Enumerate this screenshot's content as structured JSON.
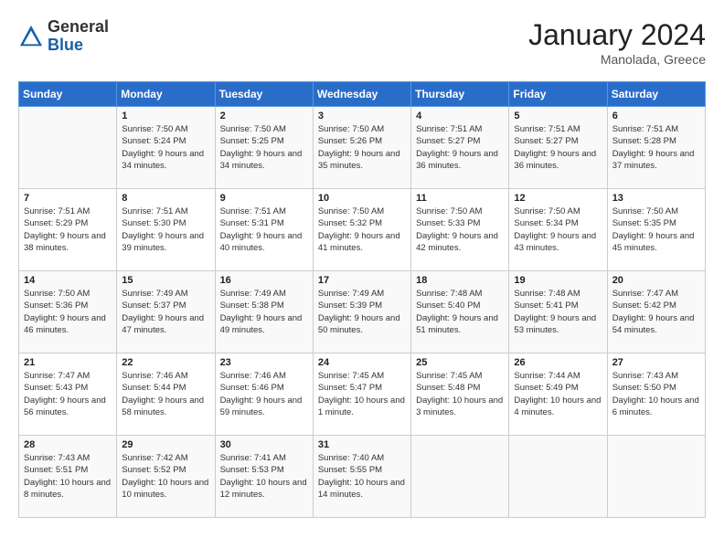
{
  "header": {
    "logo_general": "General",
    "logo_blue": "Blue",
    "month_year": "January 2024",
    "location": "Manolada, Greece"
  },
  "columns": [
    "Sunday",
    "Monday",
    "Tuesday",
    "Wednesday",
    "Thursday",
    "Friday",
    "Saturday"
  ],
  "weeks": [
    [
      {
        "day": "",
        "sunrise": "",
        "sunset": "",
        "daylight": ""
      },
      {
        "day": "1",
        "sunrise": "Sunrise: 7:50 AM",
        "sunset": "Sunset: 5:24 PM",
        "daylight": "Daylight: 9 hours and 34 minutes."
      },
      {
        "day": "2",
        "sunrise": "Sunrise: 7:50 AM",
        "sunset": "Sunset: 5:25 PM",
        "daylight": "Daylight: 9 hours and 34 minutes."
      },
      {
        "day": "3",
        "sunrise": "Sunrise: 7:50 AM",
        "sunset": "Sunset: 5:26 PM",
        "daylight": "Daylight: 9 hours and 35 minutes."
      },
      {
        "day": "4",
        "sunrise": "Sunrise: 7:51 AM",
        "sunset": "Sunset: 5:27 PM",
        "daylight": "Daylight: 9 hours and 36 minutes."
      },
      {
        "day": "5",
        "sunrise": "Sunrise: 7:51 AM",
        "sunset": "Sunset: 5:27 PM",
        "daylight": "Daylight: 9 hours and 36 minutes."
      },
      {
        "day": "6",
        "sunrise": "Sunrise: 7:51 AM",
        "sunset": "Sunset: 5:28 PM",
        "daylight": "Daylight: 9 hours and 37 minutes."
      }
    ],
    [
      {
        "day": "7",
        "sunrise": "Sunrise: 7:51 AM",
        "sunset": "Sunset: 5:29 PM",
        "daylight": "Daylight: 9 hours and 38 minutes."
      },
      {
        "day": "8",
        "sunrise": "Sunrise: 7:51 AM",
        "sunset": "Sunset: 5:30 PM",
        "daylight": "Daylight: 9 hours and 39 minutes."
      },
      {
        "day": "9",
        "sunrise": "Sunrise: 7:51 AM",
        "sunset": "Sunset: 5:31 PM",
        "daylight": "Daylight: 9 hours and 40 minutes."
      },
      {
        "day": "10",
        "sunrise": "Sunrise: 7:50 AM",
        "sunset": "Sunset: 5:32 PM",
        "daylight": "Daylight: 9 hours and 41 minutes."
      },
      {
        "day": "11",
        "sunrise": "Sunrise: 7:50 AM",
        "sunset": "Sunset: 5:33 PM",
        "daylight": "Daylight: 9 hours and 42 minutes."
      },
      {
        "day": "12",
        "sunrise": "Sunrise: 7:50 AM",
        "sunset": "Sunset: 5:34 PM",
        "daylight": "Daylight: 9 hours and 43 minutes."
      },
      {
        "day": "13",
        "sunrise": "Sunrise: 7:50 AM",
        "sunset": "Sunset: 5:35 PM",
        "daylight": "Daylight: 9 hours and 45 minutes."
      }
    ],
    [
      {
        "day": "14",
        "sunrise": "Sunrise: 7:50 AM",
        "sunset": "Sunset: 5:36 PM",
        "daylight": "Daylight: 9 hours and 46 minutes."
      },
      {
        "day": "15",
        "sunrise": "Sunrise: 7:49 AM",
        "sunset": "Sunset: 5:37 PM",
        "daylight": "Daylight: 9 hours and 47 minutes."
      },
      {
        "day": "16",
        "sunrise": "Sunrise: 7:49 AM",
        "sunset": "Sunset: 5:38 PM",
        "daylight": "Daylight: 9 hours and 49 minutes."
      },
      {
        "day": "17",
        "sunrise": "Sunrise: 7:49 AM",
        "sunset": "Sunset: 5:39 PM",
        "daylight": "Daylight: 9 hours and 50 minutes."
      },
      {
        "day": "18",
        "sunrise": "Sunrise: 7:48 AM",
        "sunset": "Sunset: 5:40 PM",
        "daylight": "Daylight: 9 hours and 51 minutes."
      },
      {
        "day": "19",
        "sunrise": "Sunrise: 7:48 AM",
        "sunset": "Sunset: 5:41 PM",
        "daylight": "Daylight: 9 hours and 53 minutes."
      },
      {
        "day": "20",
        "sunrise": "Sunrise: 7:47 AM",
        "sunset": "Sunset: 5:42 PM",
        "daylight": "Daylight: 9 hours and 54 minutes."
      }
    ],
    [
      {
        "day": "21",
        "sunrise": "Sunrise: 7:47 AM",
        "sunset": "Sunset: 5:43 PM",
        "daylight": "Daylight: 9 hours and 56 minutes."
      },
      {
        "day": "22",
        "sunrise": "Sunrise: 7:46 AM",
        "sunset": "Sunset: 5:44 PM",
        "daylight": "Daylight: 9 hours and 58 minutes."
      },
      {
        "day": "23",
        "sunrise": "Sunrise: 7:46 AM",
        "sunset": "Sunset: 5:46 PM",
        "daylight": "Daylight: 9 hours and 59 minutes."
      },
      {
        "day": "24",
        "sunrise": "Sunrise: 7:45 AM",
        "sunset": "Sunset: 5:47 PM",
        "daylight": "Daylight: 10 hours and 1 minute."
      },
      {
        "day": "25",
        "sunrise": "Sunrise: 7:45 AM",
        "sunset": "Sunset: 5:48 PM",
        "daylight": "Daylight: 10 hours and 3 minutes."
      },
      {
        "day": "26",
        "sunrise": "Sunrise: 7:44 AM",
        "sunset": "Sunset: 5:49 PM",
        "daylight": "Daylight: 10 hours and 4 minutes."
      },
      {
        "day": "27",
        "sunrise": "Sunrise: 7:43 AM",
        "sunset": "Sunset: 5:50 PM",
        "daylight": "Daylight: 10 hours and 6 minutes."
      }
    ],
    [
      {
        "day": "28",
        "sunrise": "Sunrise: 7:43 AM",
        "sunset": "Sunset: 5:51 PM",
        "daylight": "Daylight: 10 hours and 8 minutes."
      },
      {
        "day": "29",
        "sunrise": "Sunrise: 7:42 AM",
        "sunset": "Sunset: 5:52 PM",
        "daylight": "Daylight: 10 hours and 10 minutes."
      },
      {
        "day": "30",
        "sunrise": "Sunrise: 7:41 AM",
        "sunset": "Sunset: 5:53 PM",
        "daylight": "Daylight: 10 hours and 12 minutes."
      },
      {
        "day": "31",
        "sunrise": "Sunrise: 7:40 AM",
        "sunset": "Sunset: 5:55 PM",
        "daylight": "Daylight: 10 hours and 14 minutes."
      },
      {
        "day": "",
        "sunrise": "",
        "sunset": "",
        "daylight": ""
      },
      {
        "day": "",
        "sunrise": "",
        "sunset": "",
        "daylight": ""
      },
      {
        "day": "",
        "sunrise": "",
        "sunset": "",
        "daylight": ""
      }
    ]
  ]
}
